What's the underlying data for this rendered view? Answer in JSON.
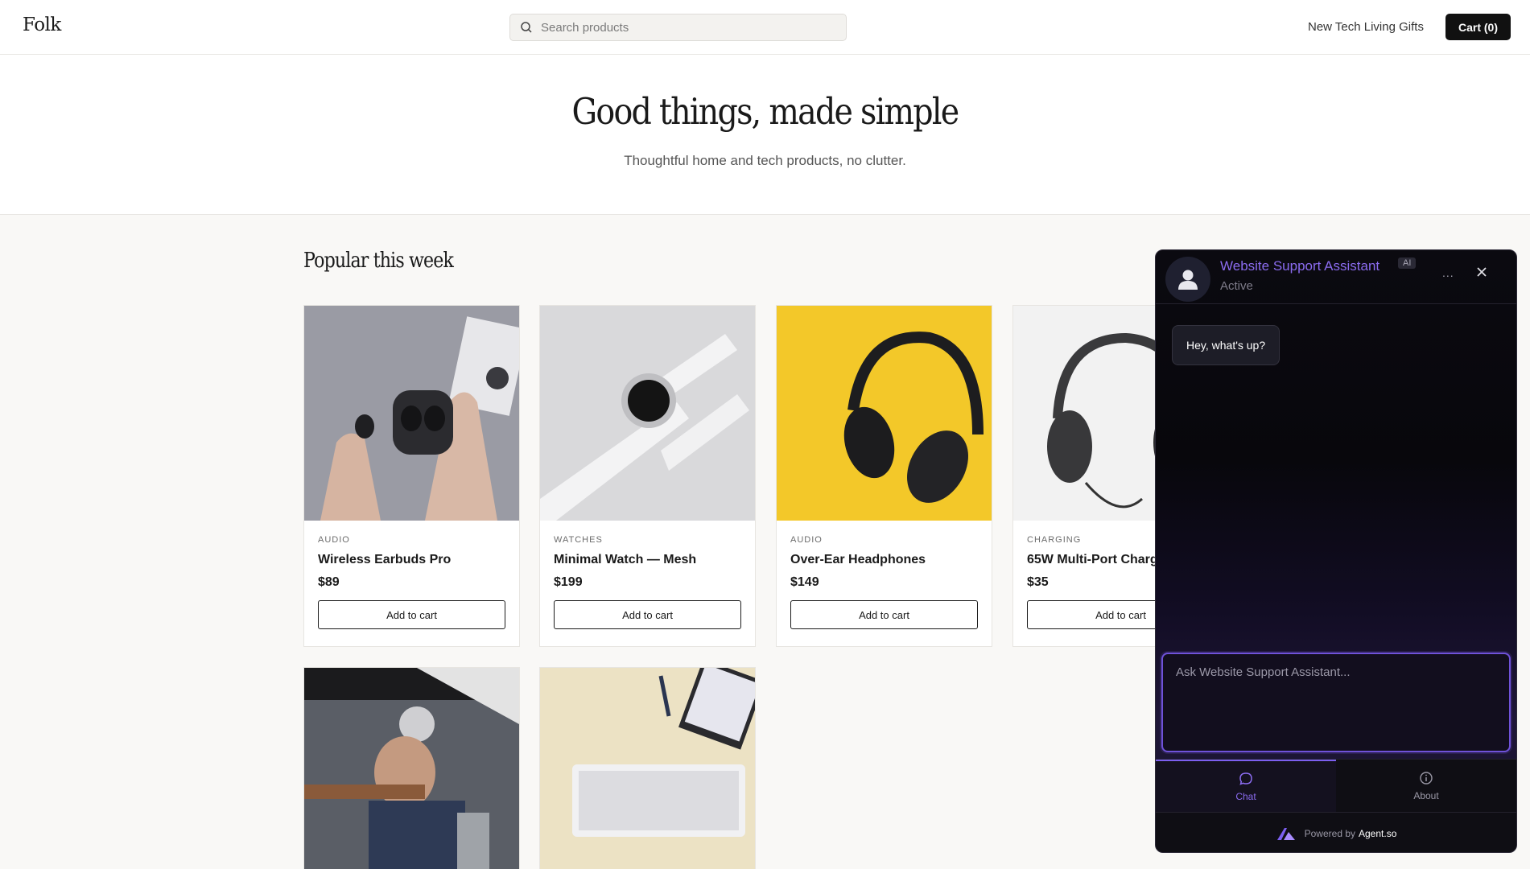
{
  "header": {
    "logo": "Folk",
    "search_placeholder": "Search products",
    "nav_links": "New Tech Living Gifts",
    "cart_label": "Cart (0)"
  },
  "hero": {
    "title": "Good things, made simple",
    "subtitle": "Thoughtful home and tech products, no clutter."
  },
  "section": {
    "title": "Popular this week"
  },
  "products": [
    {
      "category": "AUDIO",
      "name": "Wireless Earbuds Pro",
      "price": "$89",
      "button": "Add to cart"
    },
    {
      "category": "WATCHES",
      "name": "Minimal Watch — Mesh",
      "price": "$199",
      "button": "Add to cart"
    },
    {
      "category": "AUDIO",
      "name": "Over-Ear Headphones",
      "price": "$149",
      "button": "Add to cart"
    },
    {
      "category": "CHARGING",
      "name": "65W Multi-Port Charger",
      "price": "$35",
      "button": "Add to cart"
    }
  ],
  "chat": {
    "title": "Website Support Assistant",
    "badge": "AI",
    "status": "Active",
    "more": "...",
    "message": "Hey, what's up?",
    "input_placeholder": "Ask Website Support Assistant...",
    "tabs": [
      {
        "label": "Chat"
      },
      {
        "label": "About"
      }
    ],
    "powered_by": "Powered by",
    "brand": "Agent.so",
    "accent_color": "#8b6cf0"
  }
}
